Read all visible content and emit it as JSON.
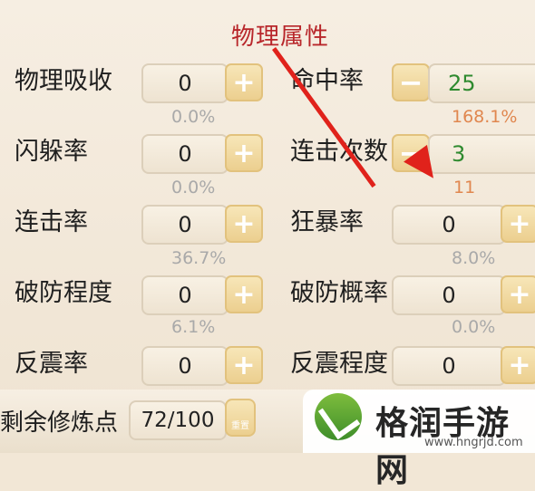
{
  "header": {
    "title": "物理属性"
  },
  "left_rows": [
    {
      "label": "物理吸收",
      "value": "0",
      "pct": "0.0%"
    },
    {
      "label": "闪躲率",
      "value": "0",
      "pct": "0.0%"
    },
    {
      "label": "连击率",
      "value": "0",
      "pct": "36.7%"
    },
    {
      "label": "破防程度",
      "value": "0",
      "pct": "6.1%"
    },
    {
      "label": "反震率",
      "value": "0"
    }
  ],
  "right_rows": [
    {
      "label": "命中率",
      "value": "25",
      "pct": "168.1%"
    },
    {
      "label": "连击次数",
      "value": "3",
      "pct": "11"
    },
    {
      "label": "狂暴率",
      "value": "0",
      "pct": "8.0%"
    },
    {
      "label": "破防概率",
      "value": "0",
      "pct": "0.0%"
    },
    {
      "label": "反震程度",
      "value": "0"
    }
  ],
  "footer": {
    "remaining_label": "剩余修炼点",
    "remaining_value": "72/100",
    "reset_label": "重置"
  },
  "watermark": {
    "brand": "格润手游网",
    "site": "www.hngrjd.com"
  },
  "colors": {
    "title": "#b8262a",
    "highlight": "#e0874f",
    "green": "#2f8a2f",
    "arrow": "#e0221b"
  },
  "icons": [
    "plus-icon",
    "minus-icon",
    "reset-icon",
    "arrow-annotation"
  ]
}
